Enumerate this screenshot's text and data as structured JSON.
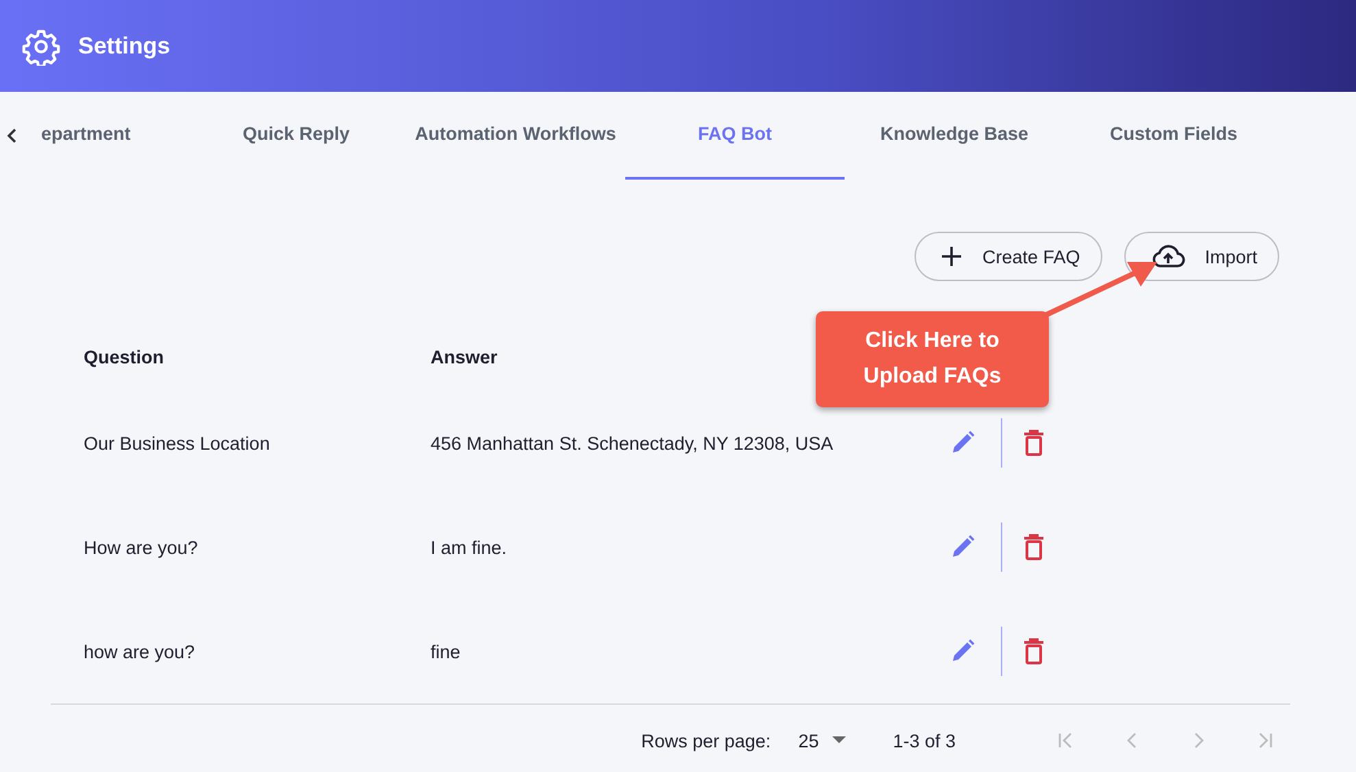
{
  "header": {
    "title": "Settings"
  },
  "tabs": [
    {
      "label": "epartment",
      "selected": false
    },
    {
      "label": "Quick Reply",
      "selected": false
    },
    {
      "label": "Automation Workflows",
      "selected": false
    },
    {
      "label": "FAQ Bot",
      "selected": true
    },
    {
      "label": "Knowledge Base",
      "selected": false
    },
    {
      "label": "Custom Fields",
      "selected": false
    }
  ],
  "actions": [
    {
      "label": "Create FAQ",
      "kind": "create"
    },
    {
      "label": "Import",
      "kind": "import"
    }
  ],
  "callout": {
    "text": "Click Here to Upload FAQs"
  },
  "table": {
    "columns": [
      "Question",
      "Answer"
    ],
    "rows": [
      {
        "question": "Our Business Location",
        "answer": "456 Manhattan St. Schenectady, NY 12308, USA"
      },
      {
        "question": "How are you?",
        "answer": "I am fine."
      },
      {
        "question": "how are you?",
        "answer": "fine"
      }
    ]
  },
  "pagination": {
    "rows_per_page_label": "Rows per page:",
    "rows_per_page": "25",
    "range": "1-3 of 3"
  }
}
